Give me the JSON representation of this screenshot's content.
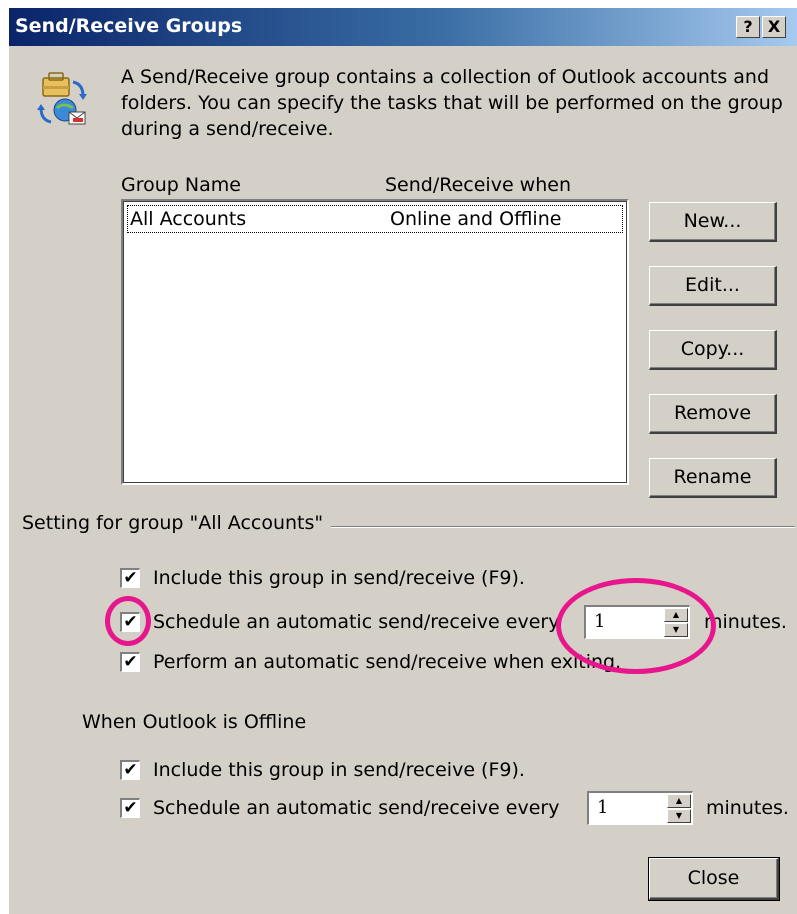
{
  "dialog": {
    "title": "Send/Receive Groups",
    "help_button": "?",
    "close_button": "X",
    "description": "A Send/Receive group contains a collection of Outlook accounts and folders. You can specify the tasks that will be performed on the group during a send/receive."
  },
  "groups_list": {
    "columns": [
      "Group Name",
      "Send/Receive when"
    ],
    "rows": [
      {
        "name": "All Accounts",
        "when": "Online and Offline"
      }
    ]
  },
  "buttons": {
    "new": "New...",
    "edit": "Edit...",
    "copy": "Copy...",
    "remove": "Remove",
    "rename": "Rename",
    "close": "Close"
  },
  "group_settings": {
    "legend": "Setting for group \"All Accounts\"",
    "online": {
      "include": {
        "label": "Include this group in send/receive (F9).",
        "checked": true
      },
      "schedule": {
        "label": "Schedule an automatic send/receive every",
        "checked": true,
        "minutes_value": "1",
        "after_label": "minutes."
      },
      "exit": {
        "label": "Perform an automatic send/receive when exiting.",
        "checked": true
      }
    },
    "offline": {
      "heading": "When Outlook is Offline",
      "include": {
        "label": "Include this group in send/receive (F9).",
        "checked": true
      },
      "schedule": {
        "label": "Schedule an automatic send/receive every",
        "checked": true,
        "minutes_value": "1",
        "after_label": "minutes."
      }
    }
  },
  "icons": {
    "dialog_icon": "send-receive-icon",
    "checkbox_mark": "✔",
    "spin_up": "▲",
    "spin_down": "▼"
  },
  "colors": {
    "titlebar_start": "#0a246a",
    "titlebar_end": "#a6caf0",
    "dialog_bg": "#d4d0c8",
    "annotation": "#e8168c"
  }
}
